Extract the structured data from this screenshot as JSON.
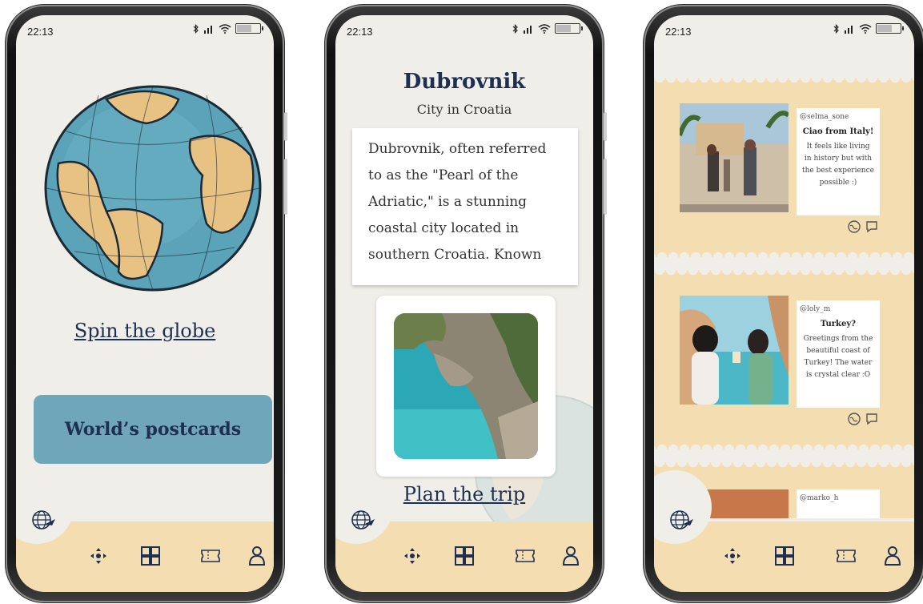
{
  "status_bar": {
    "time": "22:13"
  },
  "screen1": {
    "spin_link": "Spin the globe",
    "postcards_button": "World’s postcards"
  },
  "screen2": {
    "city": "Dubrovnik",
    "subtitle": "City in Croatia",
    "description_lines": [
      "Dubrovnik, often referred",
      "to as the \"Pearl of the",
      "Adriatic,\" is a stunning",
      "coastal city located in",
      "southern Croatia. Known"
    ],
    "plan_link": "Plan the trip"
  },
  "screen3": {
    "postcards": [
      {
        "user": "@selma_sone",
        "title": "Ciao from Italy!",
        "body": [
          "It feels like living",
          "in history but with",
          "the best experience",
          "possible :)"
        ]
      },
      {
        "user": "@loly_m",
        "title": "Turkey?",
        "body": [
          "Greetings from the",
          "beautiful coast of",
          "Turkey! The water",
          "is crystal clear :O"
        ]
      },
      {
        "user": "@marko_h",
        "title": "",
        "body": []
      }
    ]
  },
  "nav": {
    "items": [
      "move-icon",
      "grid-icon",
      "ticket-icon",
      "profile-icon"
    ]
  },
  "colors": {
    "accent": "#6fa6b9",
    "sand": "#f4ddb0",
    "ink": "#1e2f52",
    "screen_bg": "#efeee8"
  }
}
